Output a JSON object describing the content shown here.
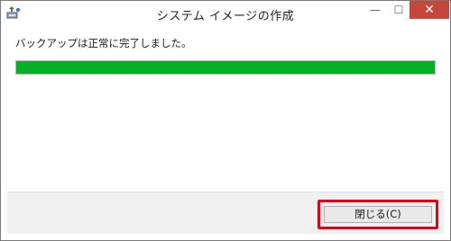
{
  "window": {
    "title": "システム イメージの作成",
    "app_icon": "backup-app-icon",
    "controls": {
      "minimize_glyph": "—",
      "maximize_glyph": "☐",
      "close_glyph": "✕",
      "close_color": "#c7463c"
    }
  },
  "content": {
    "message": "バックアップは正常に完了しました。",
    "progress": {
      "percent": 100,
      "fill_color": "#06b025"
    }
  },
  "footer": {
    "close_button_label": "閉じる(C)",
    "highlight_color": "#e60012"
  }
}
